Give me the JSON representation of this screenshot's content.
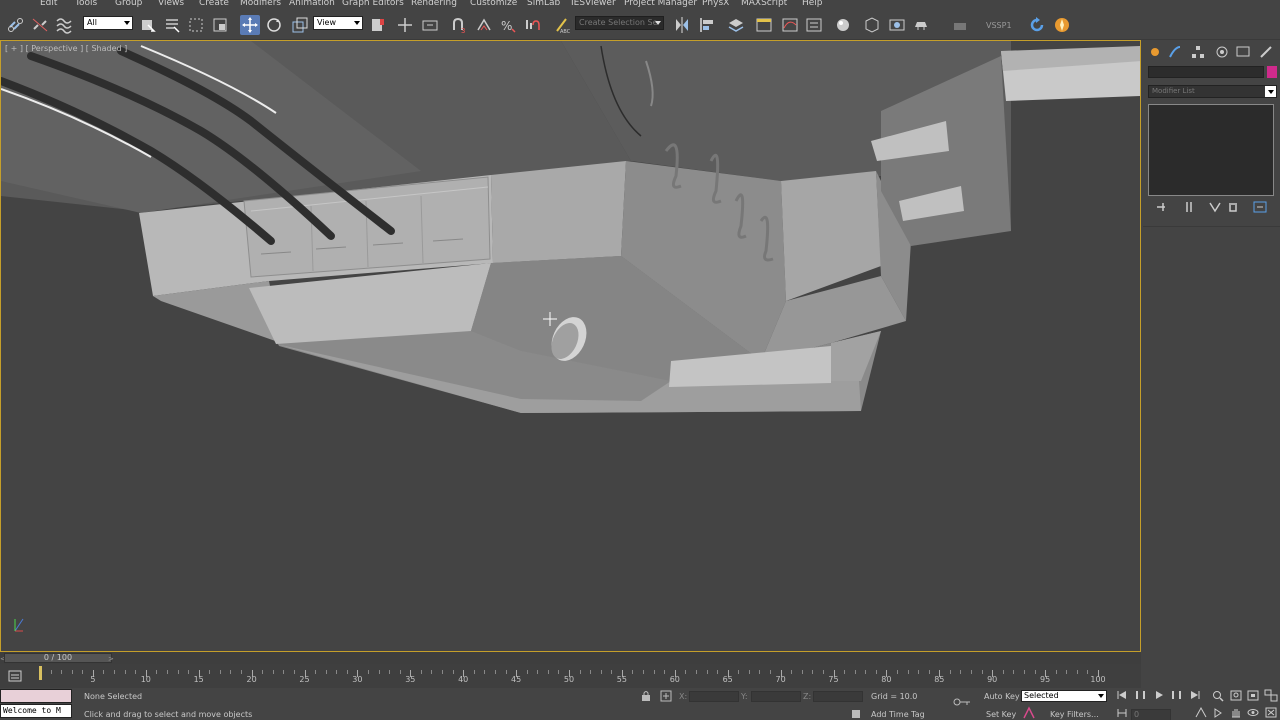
{
  "menu": [
    {
      "label": "Edit",
      "key": "edit"
    },
    {
      "label": "Tools",
      "key": "tools"
    },
    {
      "label": "Group",
      "key": "group"
    },
    {
      "label": "Views",
      "key": "views"
    },
    {
      "label": "Create",
      "key": "create"
    },
    {
      "label": "Modifiers",
      "key": "modifiers"
    },
    {
      "label": "Animation",
      "key": "animation"
    },
    {
      "label": "Graph Editors",
      "key": "graph-editors"
    },
    {
      "label": "Rendering",
      "key": "rendering"
    },
    {
      "label": "Customize",
      "key": "customize"
    },
    {
      "label": "SimLab",
      "key": "simlab"
    },
    {
      "label": "IESViewer",
      "key": "iesviewer"
    },
    {
      "label": "Project Manager",
      "key": "project-manager"
    },
    {
      "label": "PhysX",
      "key": "physx"
    },
    {
      "label": "MAXScript",
      "key": "maxscript"
    },
    {
      "label": "Help",
      "key": "help"
    }
  ],
  "toolbar": {
    "selection_filter": "All",
    "reference_coord": "View",
    "named_selection_placeholder": "Create Selection Se",
    "vssp_label": "VSSP1"
  },
  "viewport": {
    "label": "[ + ] [ Perspective ] [ Shaded ]",
    "accent_color": "#c59f2a"
  },
  "command_panel": {
    "modifier_list": "Modifier List",
    "color_swatch": "#d02a8c"
  },
  "time_slider": {
    "position": "0 / 100",
    "current_frame": 0,
    "total_frames": 100
  },
  "trackbar": {
    "labels": [
      "5",
      "10",
      "15",
      "20",
      "25",
      "30",
      "35",
      "40",
      "45",
      "50",
      "55",
      "60",
      "65",
      "70",
      "75",
      "80",
      "85",
      "90",
      "95",
      "100"
    ]
  },
  "status": {
    "maxscript_listener": "Welcome to M",
    "selection": "None Selected",
    "prompt": "Click and drag to select and move objects",
    "x_label": "X:",
    "y_label": "Y:",
    "z_label": "Z:",
    "grid": "Grid = 10.0",
    "add_time_tag": "Add Time Tag",
    "auto_key": "Auto Key",
    "set_key": "Set Key",
    "key_mode": "Selected",
    "key_filters": "Key Filters...",
    "frame_value": "0"
  }
}
